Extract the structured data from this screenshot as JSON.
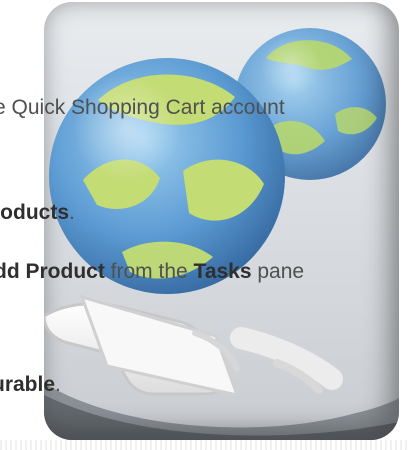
{
  "instruction_lines": [
    {
      "id": "line-1",
      "parts": [
        {
          "text": "e Quick Shopping Cart account",
          "bold": false
        }
      ]
    },
    {
      "id": "line-2",
      "parts": [
        {
          "text": "roducts",
          "bold": true
        },
        {
          "text": ".",
          "bold": false
        }
      ]
    },
    {
      "id": "line-3",
      "parts": [
        {
          "text": "dd ",
          "bold": true
        },
        {
          "text": "Product",
          "bold": true
        },
        {
          "text": " from the ",
          "bold": false
        },
        {
          "text": "Tasks",
          "bold": true
        },
        {
          "text": " pane",
          "bold": false
        }
      ]
    },
    {
      "id": "line-4",
      "parts": [
        {
          "text": "urable",
          "bold": true
        },
        {
          "text": ".",
          "bold": false
        }
      ]
    }
  ],
  "illustration": {
    "icon": "globe-shopping-cart-icon",
    "colors": {
      "globe_blue": "#5b9ad2",
      "globe_green": "#b8d86b",
      "cart_white": "#f7f7f7",
      "panel_gray": "#d6d9dc"
    }
  }
}
